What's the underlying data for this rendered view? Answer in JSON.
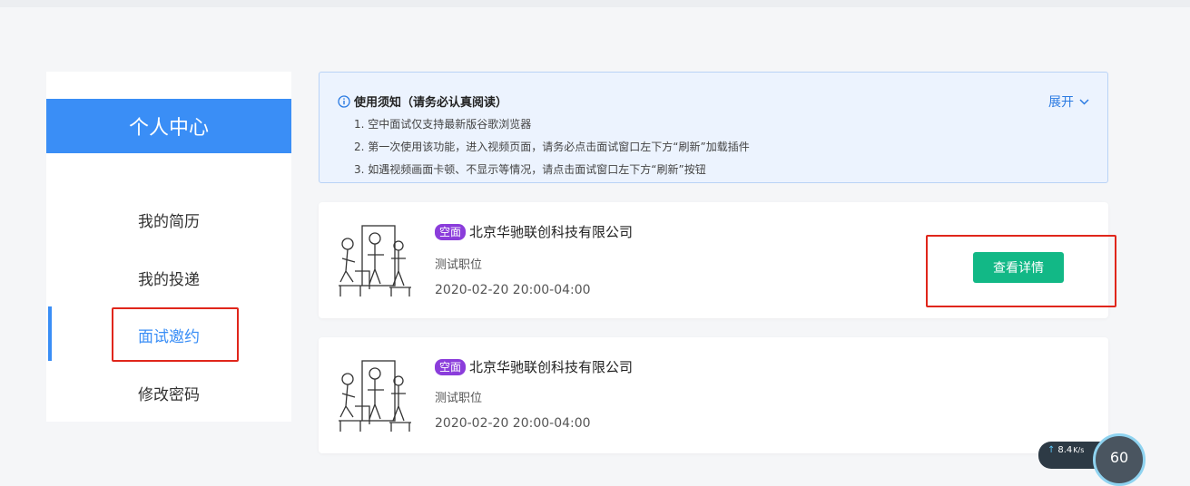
{
  "sidebar": {
    "title": "个人中心",
    "items": [
      {
        "label": "我的简历",
        "active": false
      },
      {
        "label": "我的投递",
        "active": false
      },
      {
        "label": "面试邀约",
        "active": true
      },
      {
        "label": "修改密码",
        "active": false
      }
    ]
  },
  "notice": {
    "title": "使用须知（请务必认真阅读）",
    "expand_label": "展开",
    "lines": [
      "1. 空中面试仅支持最新版谷歌浏览器",
      "2. 第一次使用该功能，进入视频页面，请务必点击面试窗口左下方“刷新”加载插件",
      "3. 如遇视频画面卡顿、不显示等情况，请点击面试窗口左下方“刷新”按钮"
    ]
  },
  "interviews": [
    {
      "tag": "空面",
      "company": "北京华驰联创科技有限公司",
      "position": "测试职位",
      "time": "2020-02-20 20:00-04:00",
      "button": "查看详情"
    },
    {
      "tag": "空面",
      "company": "北京华驰联创科技有限公司",
      "position": "测试职位",
      "time": "2020-02-20 20:00-04:00"
    }
  ],
  "speed_widget": {
    "speed": "8.4",
    "unit": "K/s",
    "value": "60"
  },
  "colors": {
    "primary": "#3a8ef6",
    "button": "#12b886",
    "tag": "#8b3ddb",
    "highlight": "#e0261b"
  }
}
